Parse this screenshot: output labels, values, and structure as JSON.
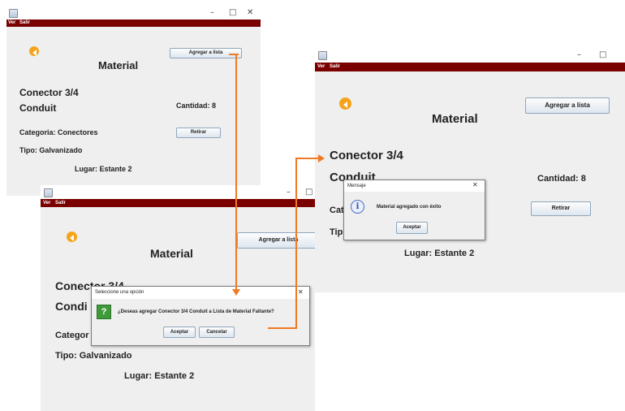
{
  "menu": {
    "ver": "Ver",
    "salir": "Salir"
  },
  "window_controls": {
    "minimize": "–",
    "maximize": "□",
    "close": "✕"
  },
  "window1": {
    "title": "Material",
    "add_button": "Agregar a lista",
    "item_line1": "Conector 3/4",
    "item_line2": "Conduit",
    "quantity": "Cantidad:  8",
    "category": "Categoria: Conectores",
    "remove_button": "Retirar",
    "type": "Tipo: Galvanizado",
    "location": "Lugar: Estante 2"
  },
  "window2": {
    "title": "Material",
    "add_button": "Agregar a lista",
    "item_line1": "Conector 3/4",
    "item_line2": "Condi",
    "category": "Categor",
    "type": "Tipo: Galvanizado",
    "location": "Lugar: Estante 2"
  },
  "confirm_dialog": {
    "title": "Seleccione una opción",
    "icon_glyph": "?",
    "message": "¿Deseas agregar Conector 3/4 Conduit a Lista de Material Faltante?",
    "accept": "Aceptar",
    "cancel": "Cancelar",
    "close": "✕"
  },
  "window3": {
    "title": "Material",
    "add_button": "Agregar a lista",
    "item_line1": "Conector 3/4",
    "item_line2": "Conduit",
    "quantity": "Cantidad:  8",
    "category": "Cat",
    "remove_button": "Retirar",
    "type": "Tip",
    "location": "Lugar: Estante 2"
  },
  "message_dialog": {
    "title": "Mensaje",
    "icon_glyph": "i",
    "message": "Material agregado con éxito",
    "accept": "Aceptar",
    "close": "✕"
  },
  "colors": {
    "menubar": "#7a0000",
    "accent": "#f5a31a",
    "connector": "#f07a24"
  }
}
